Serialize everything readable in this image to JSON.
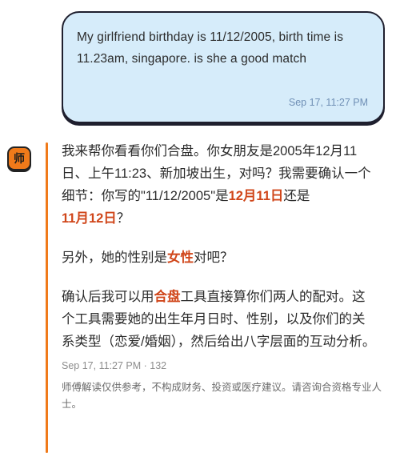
{
  "user_message": {
    "text": "My girlfriend birthday is 11/12/2005, birth time is 11.23am, singapore. is she a good match",
    "timestamp": "Sep 17, 11:27 PM"
  },
  "assistant": {
    "avatar_char": "师",
    "p1": [
      "我来帮你看看你们合盘。你女朋友是2005年12月11日、上午11:23、新加坡出生，对吗？我需要确认一个细节：你写的\"11/12/2005\"是",
      "12月11日",
      "还是",
      "11月12日",
      "？"
    ],
    "p2": [
      "另外，她的性别是",
      "女性",
      "对吧？"
    ],
    "p3": [
      "确认后我可以用",
      "合盘",
      "工具直接算你们两人的配对。这个工具需要她的出生年月日时、性别，以及你们的关系类型（恋爱/婚姻），然后给出八字层面的互动分析。"
    ],
    "meta": "Sep 17, 11:27 PM · 132",
    "disclaimer": "师傅解读仅供参考，不构成财务、投资或医疗建议。请咨询合资格专业人士。"
  },
  "colors": {
    "accent": "#f07a1a",
    "highlight": "#d0461a",
    "user_bubble_bg": "#d6ecfa",
    "border": "#1f1f2e"
  }
}
